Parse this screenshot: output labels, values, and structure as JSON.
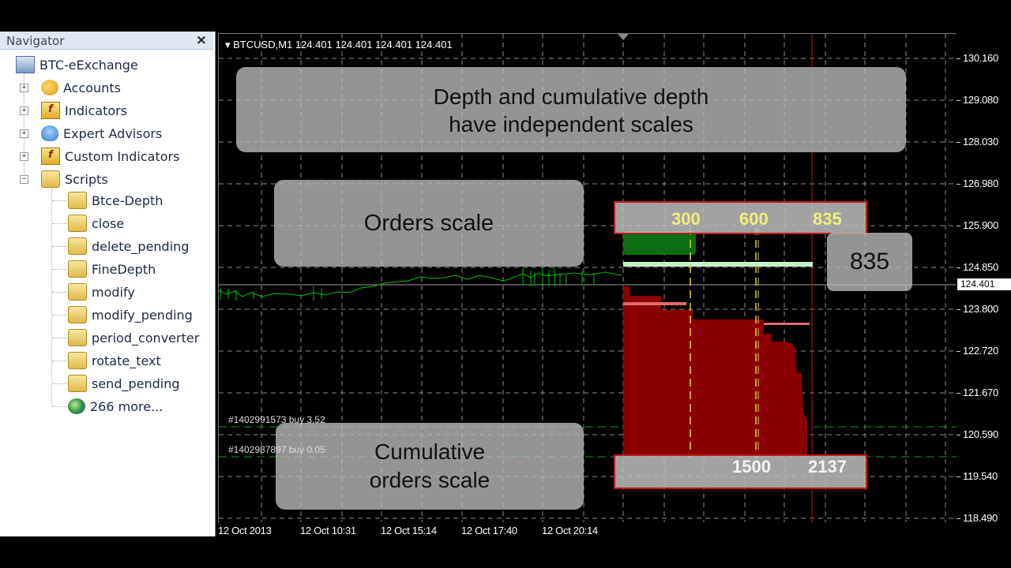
{
  "navigator": {
    "title": "Navigator",
    "close_glyph": "×",
    "root": "BTC-eExchange",
    "groups": [
      {
        "label": "Accounts",
        "icon": "accounts-icon"
      },
      {
        "label": "Indicators",
        "icon": "indicators-icon"
      },
      {
        "label": "Expert Advisors",
        "icon": "expert-advisors-icon"
      },
      {
        "label": "Custom Indicators",
        "icon": "custom-indicators-icon"
      },
      {
        "label": "Scripts",
        "icon": "scripts-icon"
      }
    ],
    "scripts": [
      "Btce-Depth",
      "close",
      "delete_pending",
      "FineDepth",
      "modify",
      "modify_pending",
      "period_converter",
      "rotate_text",
      "send_pending"
    ],
    "more": "266 more..."
  },
  "chart": {
    "symbol_line": "BTCUSD,M1  124.401 124.401 124.401 124.401",
    "y_ticks": [
      "130.160",
      "129.080",
      "128.030",
      "126.980",
      "125.900",
      "124.850",
      "124.401",
      "123.800",
      "122.720",
      "121.670",
      "120.590",
      "119.540",
      "118.490"
    ],
    "current_price": "124.401",
    "x_ticks": [
      "12 Oct 2013",
      "12 Oct 10:31",
      "12 Oct 15:14",
      "12 Oct 17:40",
      "12 Oct 20:14"
    ],
    "callout_depth_line1": "Depth and cumulative depth",
    "callout_depth_line2": "have independent scales",
    "callout_orders": "Orders scale",
    "callout_cum_line1": "Cumulative",
    "callout_cum_line2": "orders scale",
    "orders_scale": [
      "300",
      "600",
      "835"
    ],
    "cum_scale": [
      "1500",
      "2137"
    ],
    "max_label": "835",
    "order1": "#1402991573 buy 3.52",
    "order2": "#1402987897 buy 0.05",
    "colors": {
      "grid": "#888888",
      "price": "#00c000",
      "ask": "#8a0000",
      "bid": "#0a7a0a",
      "scale_border": "#c01818",
      "scale_values": "#f0f07a"
    }
  }
}
